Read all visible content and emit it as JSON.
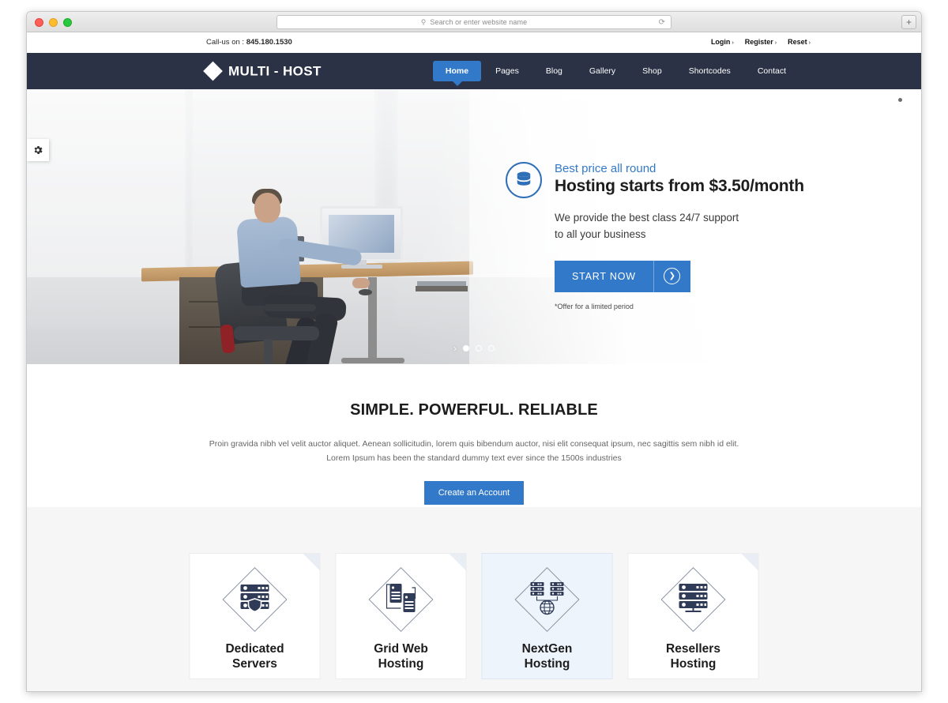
{
  "browser": {
    "address_placeholder": "Search or enter website name",
    "search_icon": "search-icon",
    "reload_icon": "reload-icon",
    "newtab_label": "+"
  },
  "topbar": {
    "call_prefix": "Call-us on : ",
    "phone": "845.180.1530",
    "links": [
      {
        "label": "Login"
      },
      {
        "label": "Register"
      },
      {
        "label": "Reset"
      }
    ],
    "caret": "›"
  },
  "nav": {
    "brand": "MULTI - HOST",
    "items": [
      {
        "label": "Home",
        "active": true
      },
      {
        "label": "Pages",
        "active": false
      },
      {
        "label": "Blog",
        "active": false
      },
      {
        "label": "Gallery",
        "active": false
      },
      {
        "label": "Shop",
        "active": false
      },
      {
        "label": "Shortcodes",
        "active": false
      },
      {
        "label": "Contact",
        "active": false
      }
    ]
  },
  "hero": {
    "icon": "database-icon",
    "eyebrow": "Best price all round",
    "title": "Hosting starts from $3.50/month",
    "subtitle_line1": "We provide the best class 24/7 support",
    "subtitle_line2": "to all your business",
    "cta_label": "START NOW",
    "cta_icon": "circle-arrow-right-icon",
    "offer_note": "*Offer for a limited period",
    "carousel": {
      "prev": "›",
      "slides": 3,
      "active_index": 0
    },
    "settings_icon": "gear-icon"
  },
  "intro": {
    "title": "SIMPLE. POWERFUL. RELIABLE",
    "body": "Proin gravida nibh vel velit auctor aliquet. Aenean sollicitudin, lorem quis bibendum auctor, nisi elit consequat ipsum, nec sagittis sem nibh id elit. Lorem Ipsum has been the  standard dummy text ever since the 1500s industries",
    "cta_label": "Create an Account"
  },
  "cards": [
    {
      "title_line1": "Dedicated",
      "title_line2": "Servers",
      "icon": "server-shield-icon",
      "highlight": false,
      "corner_fold": true
    },
    {
      "title_line1": "Grid Web",
      "title_line2": "Hosting",
      "icon": "linked-towers-icon",
      "highlight": false,
      "corner_fold": true
    },
    {
      "title_line1": "NextGen",
      "title_line2": "Hosting",
      "icon": "servers-globe-icon",
      "highlight": true,
      "corner_fold": false
    },
    {
      "title_line1": "Resellers",
      "title_line2": "Hosting",
      "icon": "server-rack-icon",
      "highlight": false,
      "corner_fold": true
    }
  ],
  "colors": {
    "accent_blue": "#3379c9",
    "nav_dark": "#2b3245",
    "icon_navy": "#2f3b57",
    "section_gray": "#f6f6f6"
  }
}
